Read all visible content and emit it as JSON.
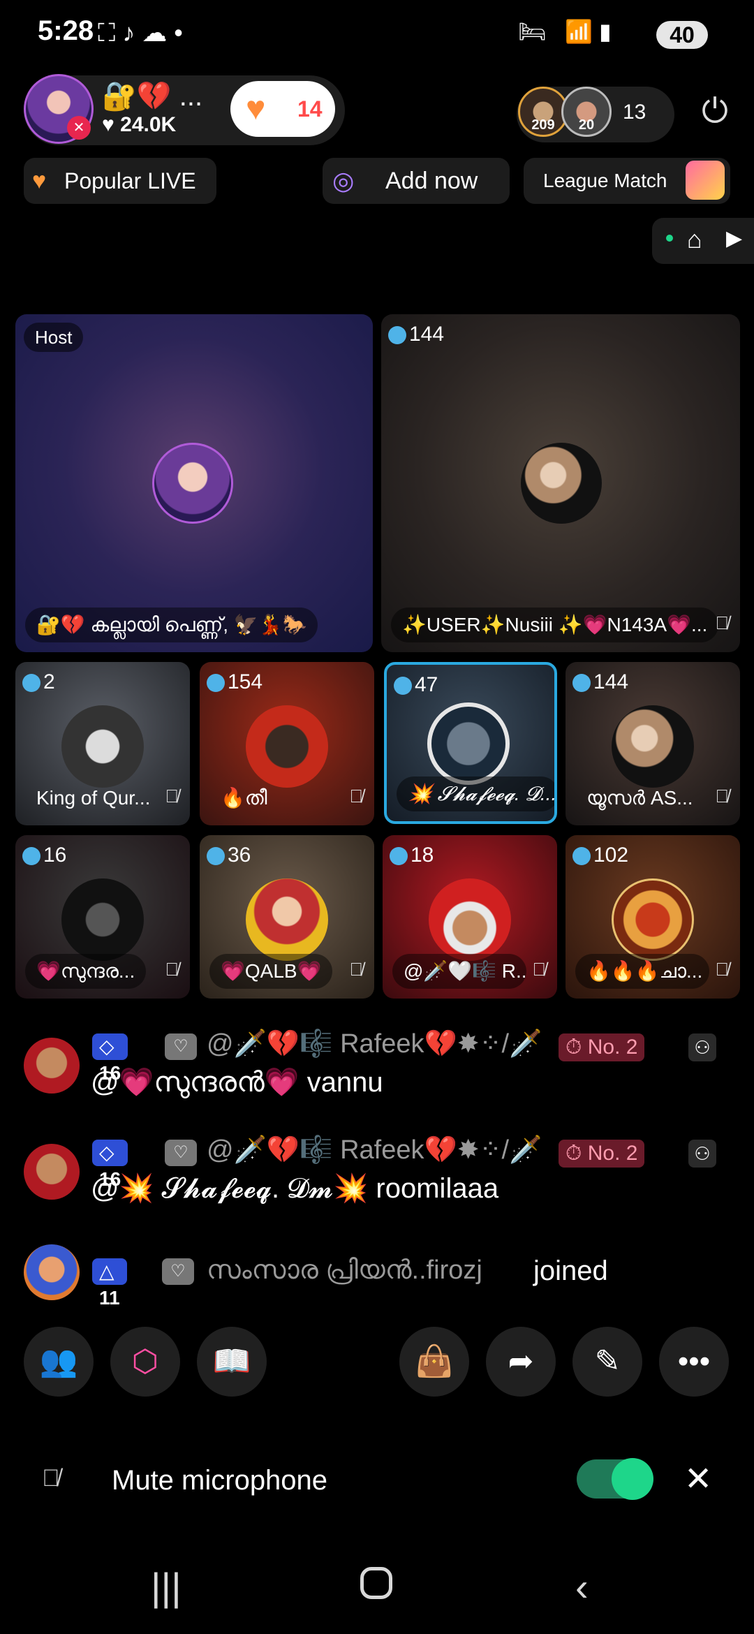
{
  "status_bar": {
    "time": "5:28",
    "battery": "40"
  },
  "host": {
    "emojis": "🔐💔 ...",
    "likes": "♥ 24.0K"
  },
  "like_button": {
    "count": "14"
  },
  "viewers": {
    "badge1": "209",
    "badge2": "20",
    "count": "13"
  },
  "chips": {
    "popular": "Popular LIVE",
    "add": "Add now",
    "league": "League Match"
  },
  "tiles": {
    "host_tag": "Host",
    "host_label": "🔐💔 കല്ലായി പെണ്ണ്, 🦅💃🐎",
    "guest1_count": "144",
    "guest1_label": "✨USER✨Nusiii ✨💗N143A💗...",
    "row2": [
      {
        "count": "2",
        "label": "King of Qur..."
      },
      {
        "count": "154",
        "label": "🔥തീ"
      },
      {
        "count": "47",
        "label": "💥 𝓢𝓱𝓪𝓯𝓮𝓮𝓺. 𝓓..."
      },
      {
        "count": "144",
        "label": "യൂസർ AS..."
      }
    ],
    "row3": [
      {
        "count": "16",
        "label": "💗സുന്ദര..."
      },
      {
        "count": "36",
        "label": "💗QALB💗"
      },
      {
        "count": "18",
        "label": "@🗡️🤍🎼 R..."
      },
      {
        "count": "102",
        "label": "🔥🔥🔥ചാ..."
      }
    ]
  },
  "chat": [
    {
      "rank": "16",
      "name": "@🗡️💔🎼 Rafeek💔✸⁘/🗡️",
      "badge": "No. 2",
      "message": "@💗സുന്ദരൻ💗 vannu"
    },
    {
      "rank": "16",
      "name": "@🗡️💔🎼 Rafeek💔✸⁘/🗡️",
      "badge": "No. 2",
      "message": "@💥 𝓢𝓱𝓪𝓯𝓮𝓮𝓺. 𝓓𝓶💥 roomilaaa"
    },
    {
      "rank": "11",
      "name": "സംസാര പ്രിയൻ..firozj",
      "message": "joined"
    }
  ],
  "mute": {
    "label": "Mute microphone"
  },
  "colors": {
    "accent": "#1ed68a",
    "selected_tile": "#2aa9e0",
    "rank_badge": "#2e4fd6"
  }
}
